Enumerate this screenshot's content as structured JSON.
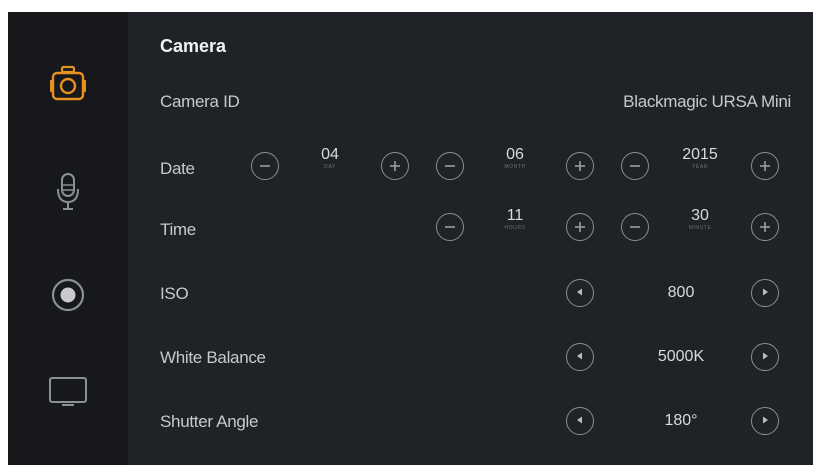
{
  "sidebar": {
    "items": [
      {
        "icon": "camera-icon",
        "active": true
      },
      {
        "icon": "microphone-icon",
        "active": false
      },
      {
        "icon": "record-icon",
        "active": false
      },
      {
        "icon": "monitor-icon",
        "active": false
      }
    ],
    "accent_color": "#e8911f"
  },
  "page": {
    "title": "Camera"
  },
  "camera_id": {
    "label": "Camera ID",
    "value": "Blackmagic URSA Mini"
  },
  "date": {
    "label": "Date",
    "day": {
      "value": "04",
      "unit": "DAY"
    },
    "month": {
      "value": "06",
      "unit": "MONTH"
    },
    "year": {
      "value": "2015",
      "unit": "YEAR"
    }
  },
  "time": {
    "label": "Time",
    "hours": {
      "value": "11",
      "unit": "HOURS"
    },
    "minutes": {
      "value": "30",
      "unit": "MINUTE"
    }
  },
  "iso": {
    "label": "ISO",
    "value": "800"
  },
  "white_balance": {
    "label": "White Balance",
    "value": "5000K"
  },
  "shutter_angle": {
    "label": "Shutter Angle",
    "value": "180°"
  }
}
